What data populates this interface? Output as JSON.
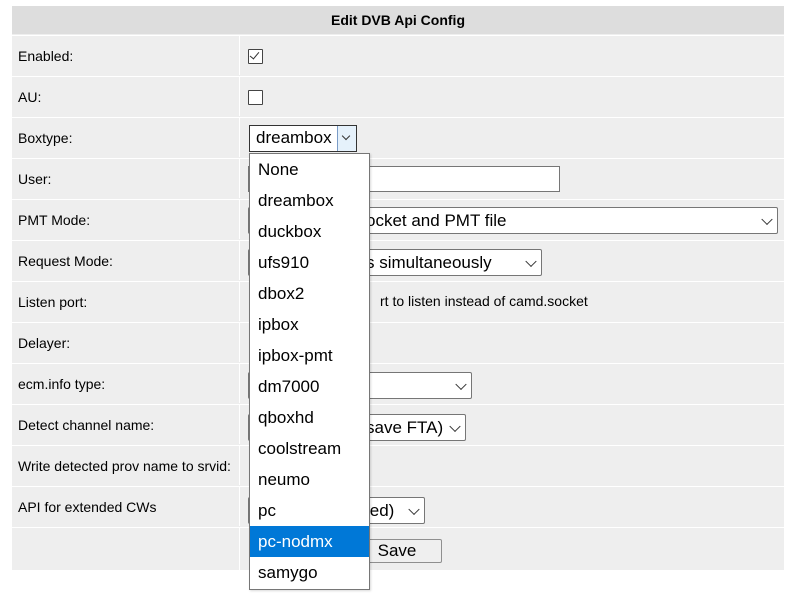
{
  "header": {
    "title": "Edit DVB Api Config"
  },
  "rows": {
    "enabled": {
      "label": "Enabled:",
      "checked": true
    },
    "au": {
      "label": "AU:",
      "checked": false
    },
    "boxtype": {
      "label": "Boxtype:",
      "value": "dreambox"
    },
    "user": {
      "label": "User:",
      "value": ""
    },
    "pmt_mode": {
      "label": "PMT Mode:",
      "value": "use camd.socket and PMT file",
      "visible_fragment": "ocket and PMT file"
    },
    "request_mode": {
      "label": "Request Mode:",
      "visible_fragment": "s simultaneously"
    },
    "listen_port": {
      "label": "Listen port:",
      "hint_fragment": "rt to listen instead of camd.socket"
    },
    "delayer": {
      "label": "Delayer:"
    },
    "ecm_info_type": {
      "label": "ecm.info type:"
    },
    "detect_channel_name": {
      "label": "Detect channel name:",
      "visible_fragment": "save FTA)"
    },
    "write_prov_name": {
      "label": "Write detected prov name to srvid:"
    },
    "api_extended_cws": {
      "label": "API for extended CWs",
      "visible_fragment": "led)"
    },
    "save": {
      "label": "Save"
    }
  },
  "boxtype_options": [
    "None",
    "dreambox",
    "duckbox",
    "ufs910",
    "dbox2",
    "ipbox",
    "ipbox-pmt",
    "dm7000",
    "qboxhd",
    "coolstream",
    "neumo",
    "pc",
    "pc-nodmx",
    "samygo"
  ],
  "boxtype_highlighted": "pc-nodmx",
  "colors": {
    "highlight": "#0078d7",
    "panel": "#eeeeee",
    "header": "#dddddd"
  },
  "icons": {
    "checkbox_checked": "check-icon",
    "select_arrow": "chevron-down-icon"
  }
}
